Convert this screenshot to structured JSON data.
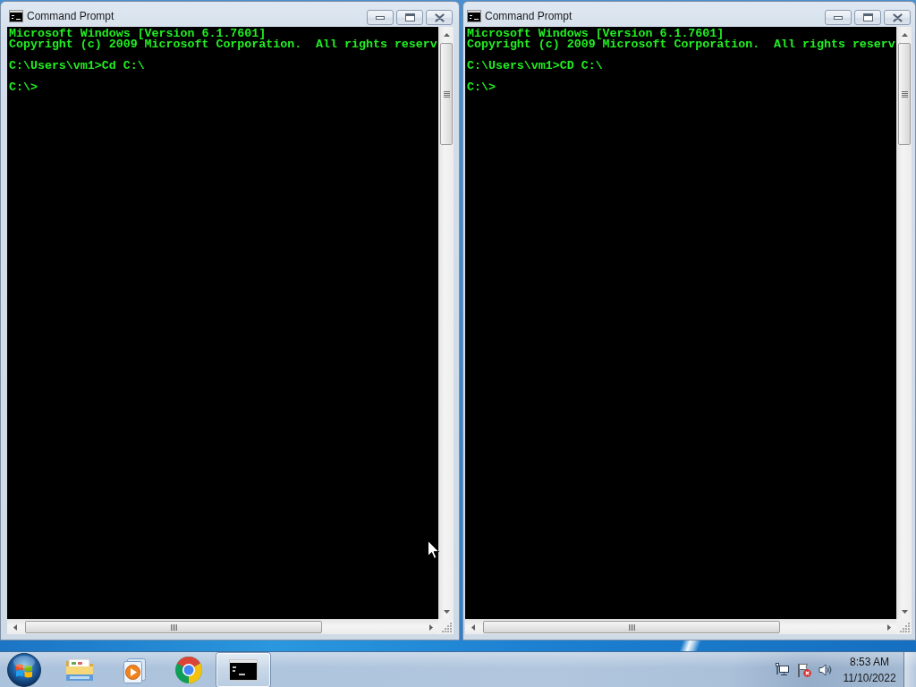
{
  "windows": [
    {
      "title": "Command Prompt",
      "console_blocks": [
        [
          "Microsoft Windows [Version 6.1.7601]",
          "Copyright (c) 2009 Microsoft Corporation.  All rights reserv"
        ],
        [
          "C:\\Users\\vm1>Cd C:\\"
        ],
        [
          "C:\\>"
        ]
      ]
    },
    {
      "title": "Command Prompt",
      "console_blocks": [
        [
          "Microsoft Windows [Version 6.1.7601]",
          "Copyright (c) 2009 Microsoft Corporation.  All rights reserv"
        ],
        [
          "C:\\Users\\vm1>CD C:\\"
        ],
        [
          "C:\\>"
        ]
      ]
    }
  ],
  "taskbar": {
    "buttons": [
      {
        "kind": "folder",
        "running": false
      },
      {
        "kind": "media",
        "running": false
      },
      {
        "kind": "browser",
        "running": false
      },
      {
        "kind": "console",
        "running": true
      }
    ],
    "clock": {
      "time": "8:53 AM",
      "date": "11/10/2022"
    }
  }
}
